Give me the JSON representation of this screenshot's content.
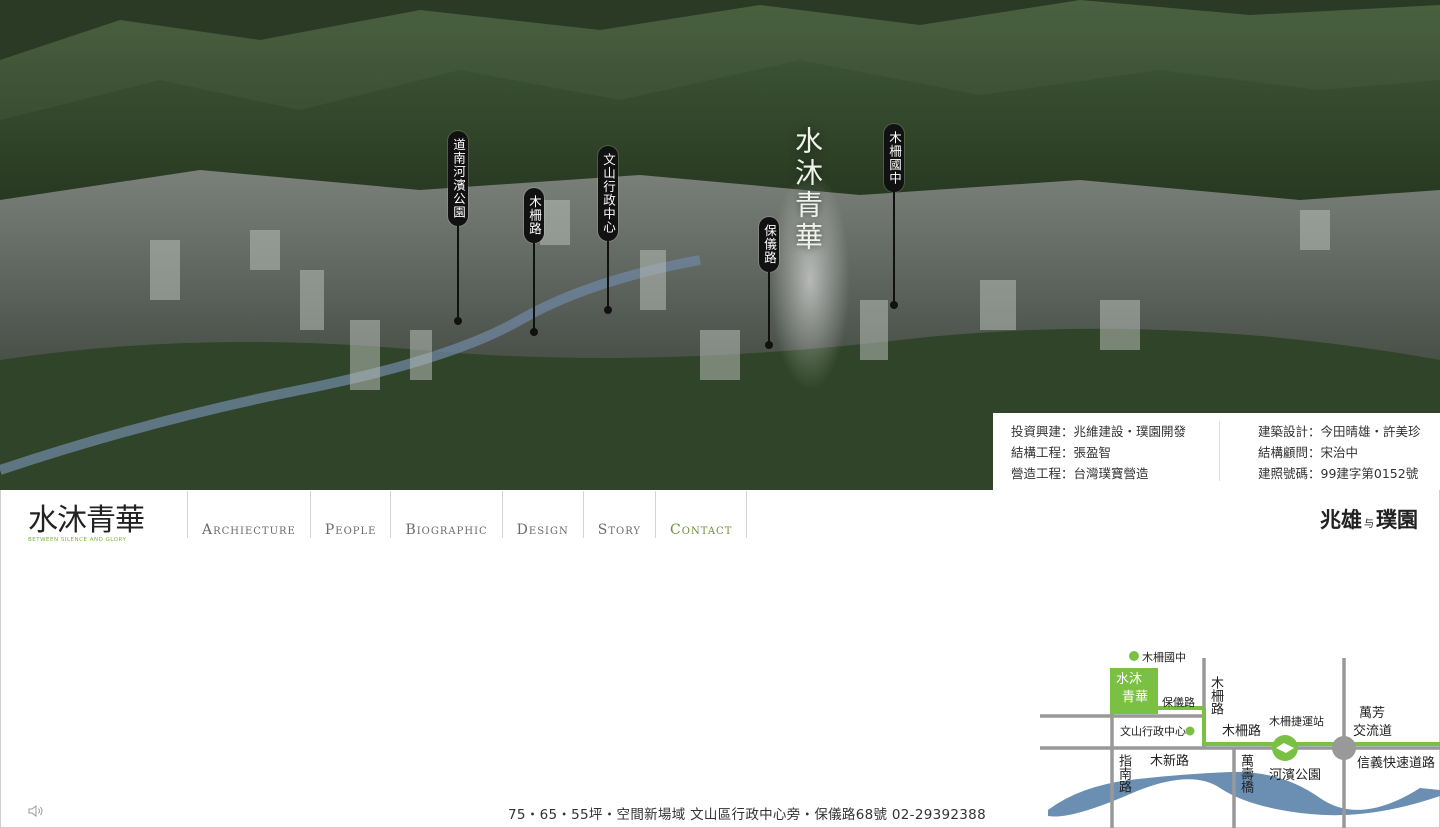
{
  "hero": {
    "title": "水沐青華",
    "pins": [
      {
        "label": "道南河濱公園"
      },
      {
        "label": "木柵路"
      },
      {
        "label": "文山行政中心"
      },
      {
        "label": "保儀路"
      },
      {
        "label": "木柵國中"
      }
    ]
  },
  "credits": {
    "left": [
      "投資興建：兆維建設・璞園開發",
      "結構工程：張盈智",
      "營造工程：台灣璞寶營造"
    ],
    "right": [
      "建築設計：今田晴雄・許美珍",
      "結構顧問：宋治中",
      "建照號碼：99建字第0152號"
    ]
  },
  "logo": {
    "text": "水沐青華",
    "subtitle": "BETWEEN SILENCE AND GLORY"
  },
  "nav": {
    "items": [
      {
        "label": "Archiecture"
      },
      {
        "label": "People"
      },
      {
        "label": "Biographic"
      },
      {
        "label": "Design"
      },
      {
        "label": "Story"
      },
      {
        "label": "Contact"
      }
    ],
    "active": "Contact"
  },
  "brand": {
    "left": "兆雄",
    "mid": "与",
    "right": "璞園"
  },
  "map": {
    "labels": {
      "school": "木柵國中",
      "logo_top": "水沐",
      "logo_bottom": "青華",
      "baoyi": "保儀路",
      "muzha_v": "木柵路",
      "muzha": "木柵路",
      "admin": "文山行政中心",
      "station": "木柵捷運站",
      "wanfang": "萬芳",
      "interchange": "交流道",
      "zhinan": "指南路",
      "muxin": "木新路",
      "wanshou": "萬壽橋",
      "riverside": "河濱公園",
      "xinyi": "信義快速道路"
    },
    "colors": {
      "road": "#999999",
      "accent": "#7ac143",
      "river": "#6a8fb3"
    }
  },
  "footer": {
    "text": "75・65・55坪・空間新場域 文山區行政中心旁・保儀路68號 02-29392388"
  },
  "icons": {
    "sound": "sound-icon"
  }
}
